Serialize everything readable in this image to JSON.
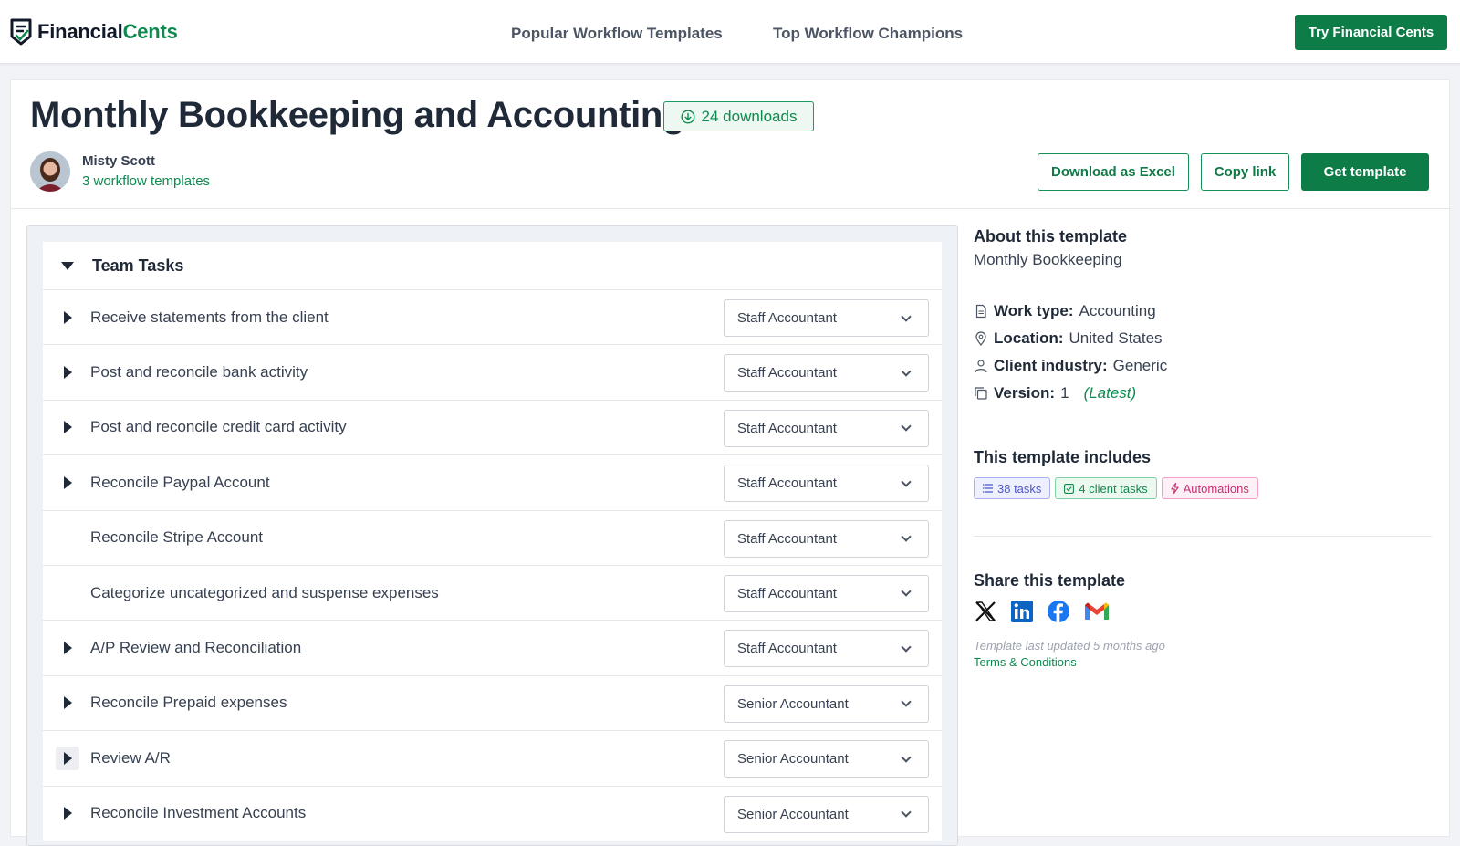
{
  "brand": {
    "name_part1": "Financial",
    "name_part2": "Cents"
  },
  "nav": {
    "links": [
      "Popular Workflow Templates",
      "Top Workflow Champions"
    ],
    "cta": "Try Financial Cents"
  },
  "template": {
    "title": "Monthly Bookkeeping and Accounting",
    "downloads": "24 downloads",
    "author": "Misty Scott",
    "author_link": "3 workflow templates",
    "buttons": {
      "excel": "Download as Excel",
      "copy": "Copy link",
      "get": "Get template"
    }
  },
  "tasks": {
    "section_title": "Team Tasks",
    "rows": [
      {
        "name": "Receive statements from the client",
        "role": "Staff Accountant",
        "expandable": true
      },
      {
        "name": "Post and reconcile bank activity",
        "role": "Staff Accountant",
        "expandable": true
      },
      {
        "name": "Post and reconcile credit card activity",
        "role": "Staff Accountant",
        "expandable": true
      },
      {
        "name": "Reconcile Paypal Account",
        "role": "Staff Accountant",
        "expandable": true
      },
      {
        "name": "Reconcile Stripe Account",
        "role": "Staff Accountant",
        "expandable": false
      },
      {
        "name": "Categorize uncategorized and suspense expenses",
        "role": "Staff Accountant",
        "expandable": false
      },
      {
        "name": "A/P Review and Reconciliation",
        "role": "Staff Accountant",
        "expandable": true
      },
      {
        "name": "Reconcile Prepaid expenses",
        "role": "Senior Accountant",
        "expandable": true
      },
      {
        "name": "Review A/R",
        "role": "Senior Accountant",
        "expandable": true,
        "highlighted": true
      },
      {
        "name": "Reconcile Investment Accounts",
        "role": "Senior Accountant",
        "expandable": true
      }
    ]
  },
  "about": {
    "heading": "About this template",
    "description": "Monthly Bookkeeping",
    "work_type_label": "Work type:",
    "work_type": "Accounting",
    "location_label": "Location:",
    "location": "United States",
    "industry_label": "Client industry:",
    "industry": "Generic",
    "version_label": "Version:",
    "version": "1",
    "version_tag": "(Latest)"
  },
  "includes": {
    "heading": "This template includes",
    "chips": [
      "38 tasks",
      "4 client tasks",
      "Automations"
    ]
  },
  "share": {
    "heading": "Share this template",
    "icons": [
      "x-icon",
      "linkedin-icon",
      "facebook-icon",
      "gmail-icon"
    ],
    "updated": "Template last updated 5 months ago",
    "terms": "Terms & Conditions"
  },
  "colors": {
    "brand_green": "#0e7c47",
    "accent_green": "#0f8a4f"
  }
}
